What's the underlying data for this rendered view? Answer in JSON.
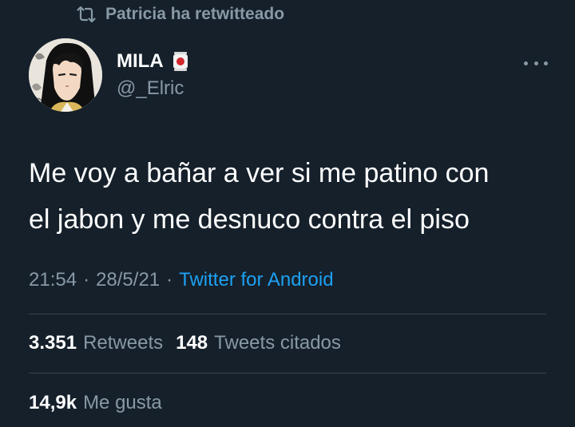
{
  "retweet_context": {
    "icon": "retweet-icon",
    "text": "Patricia ha retwitteado"
  },
  "author": {
    "display_name": "MILA",
    "name_emoji": "shrine-lantern-emoji",
    "handle": "@_Elric",
    "avatar": "anime-character-avatar"
  },
  "tweet": {
    "text": "Me voy a bañar a ver si me patino con\nel jabon y me desnuco contra el piso",
    "time": "21:54",
    "date": "28/5/21",
    "separator": "·",
    "source": "Twitter for Android"
  },
  "stats": {
    "retweets_count": "3.351",
    "retweets_label": "Retweets",
    "quotes_count": "148",
    "quotes_label": "Tweets citados",
    "likes_count": "14,9k",
    "likes_label": "Me gusta"
  },
  "colors": {
    "background": "#15202b",
    "text": "#ffffff",
    "secondary": "#8899a6",
    "link": "#1da1f2",
    "divider": "#38444d"
  }
}
